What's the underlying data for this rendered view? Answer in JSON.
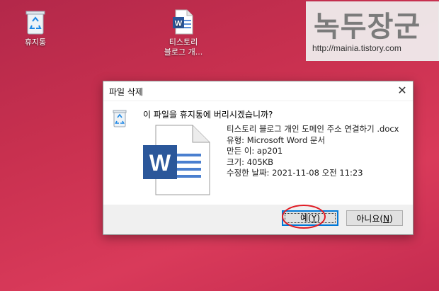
{
  "desktop": {
    "recycle_bin": {
      "label": "휴지통"
    },
    "word_file": {
      "label_line1": "티스토리",
      "label_line2": "블로그 개..."
    }
  },
  "watermark": {
    "title": "녹두장군",
    "url": "http://mainia.tistory.com"
  },
  "dialog": {
    "title": "파일 삭제",
    "close_glyph": "✕",
    "question": "이 파일을 휴지통에 버리시겠습니까?",
    "file": {
      "name": "티스토리 블로그 개인 도메인 주소 연결하기 .docx",
      "type": "유형: Microsoft Word 문서",
      "author": "만든 이: ap201",
      "size": "크기: 405KB",
      "modified": "수정한 날짜: 2021-11-08 오전 11:23"
    },
    "buttons": {
      "yes_text": "예(",
      "yes_key": "Y",
      "yes_end": ")",
      "no_text": "아니요(",
      "no_key": "N",
      "no_end": ")"
    }
  },
  "icons": {
    "recycle": "recycle-bin-icon",
    "word": "word-document-icon"
  },
  "colors": {
    "accent": "#0078d7",
    "annotation": "#e01b24",
    "word_blue": "#2b579a"
  }
}
